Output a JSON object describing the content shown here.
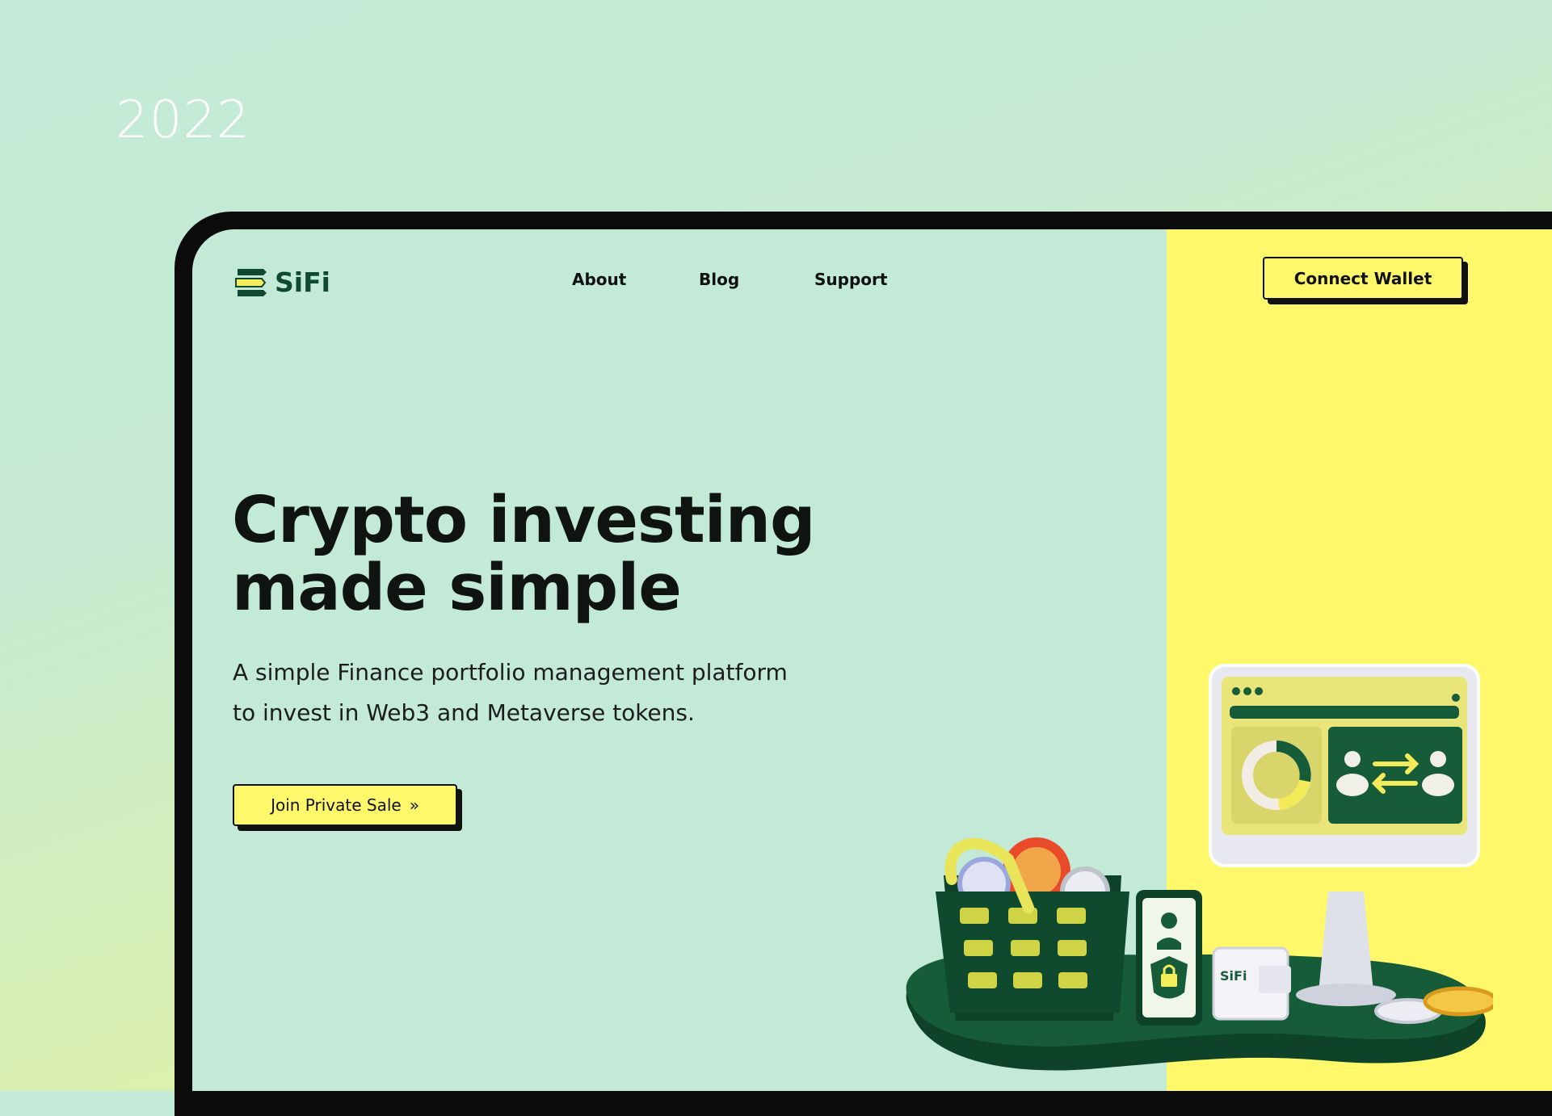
{
  "year": "2022",
  "brand": {
    "name": "SiFi",
    "logo_icon": "sifi-logo-icon"
  },
  "nav": {
    "items": [
      "About",
      "Blog",
      "Support"
    ]
  },
  "header": {
    "connect_wallet": "Connect Wallet"
  },
  "hero": {
    "title_line1": "Crypto investing",
    "title_line2": "made simple",
    "subtitle_line1": "A simple Finance portfolio management platform",
    "subtitle_line2": "to invest in Web3 and Metaverse tokens.",
    "cta_label": "Join Private Sale",
    "cta_icon": "double-chevron-right-icon"
  },
  "illustration": {
    "wallet_brand": "SiFi"
  },
  "colors": {
    "mint": "#c2ead7",
    "yellow": "#fff86b",
    "dark_green": "#0f4a30",
    "black": "#111111"
  }
}
